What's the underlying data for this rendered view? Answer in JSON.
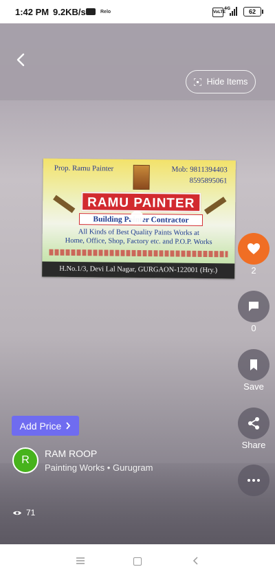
{
  "status_bar": {
    "time": "1:42 PM",
    "network_speed": "9.2KB/s",
    "notification_text": "Relo",
    "volte": "VoLTE",
    "signal": "4G",
    "battery": "62"
  },
  "header": {
    "hide_items_label": "Hide Items"
  },
  "card": {
    "prop": "Prop. Ramu Painter",
    "mobile_1": "Mob: 9811394403",
    "mobile_2": "8595895061",
    "title": "RAMU PAINTER",
    "subtitle": "Building Painter Contractor",
    "line1": "All Kinds of Best Quality Paints Works at",
    "line2": "Home, Office, Shop, Factory etc. and P.O.P. Works",
    "address": "H.No.1/3, Devi Lal Nagar, GURGAON-122001 (Hry.)"
  },
  "actions": {
    "like_count": "2",
    "comment_count": "0",
    "save_label": "Save",
    "share_label": "Share"
  },
  "overlay": {
    "add_price_label": "Add Price",
    "avatar_initial": "R",
    "owner_name": "RAM ROOP",
    "owner_subtitle": "Painting Works • Gurugram",
    "views": "71"
  },
  "colors": {
    "accent_like": "#f06e24",
    "add_price_bg": "#6f6cf0",
    "avatar_bg": "#47b31c"
  }
}
